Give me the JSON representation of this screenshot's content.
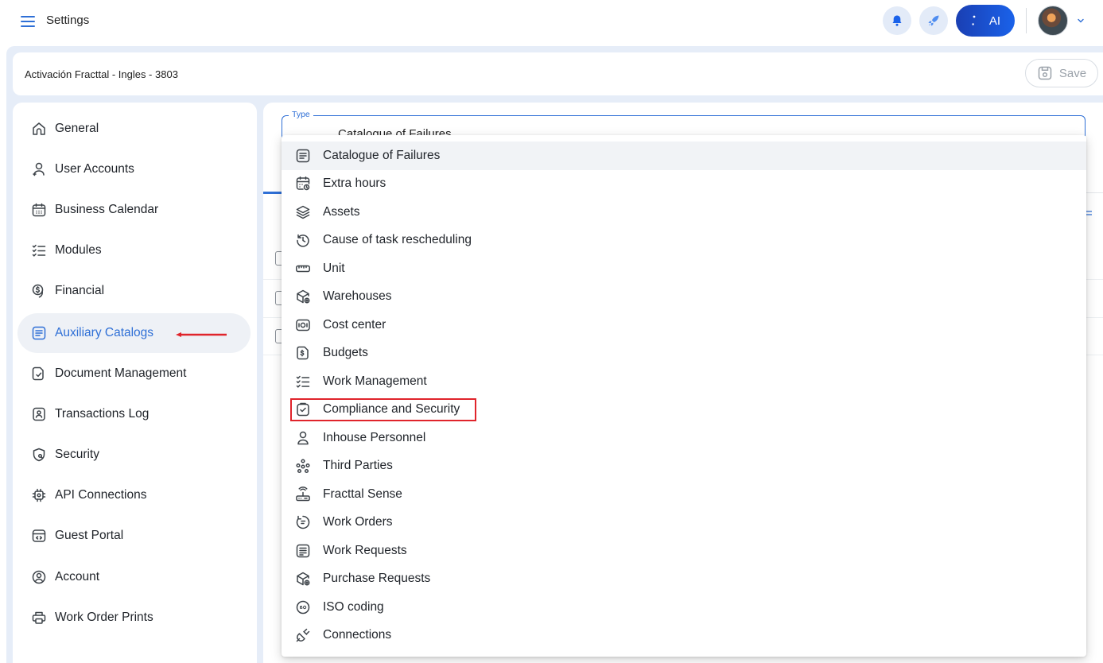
{
  "topbar": {
    "title": "Settings",
    "ai_label": "AI"
  },
  "subheader": {
    "title": "Activación Fracttal - Ingles - 3803",
    "save_label": "Save"
  },
  "sidebar": {
    "items": [
      {
        "label": "General",
        "icon": "home-icon"
      },
      {
        "label": "User Accounts",
        "icon": "user-plus-icon"
      },
      {
        "label": "Business Calendar",
        "icon": "calendar-icon"
      },
      {
        "label": "Modules",
        "icon": "checklist-icon"
      },
      {
        "label": "Financial",
        "icon": "coins-icon"
      },
      {
        "label": "Auxiliary Catalogs",
        "icon": "catalog-icon",
        "active": true
      },
      {
        "label": "Document Management",
        "icon": "document-icon"
      },
      {
        "label": "Transactions Log",
        "icon": "log-icon"
      },
      {
        "label": "Security",
        "icon": "shield-icon"
      },
      {
        "label": "API Connections",
        "icon": "chip-gear-icon"
      },
      {
        "label": "Guest Portal",
        "icon": "portal-icon"
      },
      {
        "label": "Account",
        "icon": "account-icon"
      },
      {
        "label": "Work Order Prints",
        "icon": "printer-icon"
      }
    ]
  },
  "type_field": {
    "label": "Type",
    "value": "Catalogue of Failures"
  },
  "dropdown": {
    "options": [
      {
        "label": "Catalogue of Failures",
        "icon": "list-doc-icon",
        "hover": true
      },
      {
        "label": "Extra hours",
        "icon": "calendar-clock-icon"
      },
      {
        "label": "Assets",
        "icon": "layers-icon"
      },
      {
        "label": "Cause of task rescheduling",
        "icon": "history-icon"
      },
      {
        "label": "Unit",
        "icon": "ruler-icon"
      },
      {
        "label": "Warehouses",
        "icon": "box-plus-icon"
      },
      {
        "label": "Cost center",
        "icon": "cost-center-icon"
      },
      {
        "label": "Budgets",
        "icon": "budget-icon"
      },
      {
        "label": "Work Management",
        "icon": "checklist-icon"
      },
      {
        "label": "Compliance and Security",
        "icon": "clipboard-check-icon",
        "highlighted": true
      },
      {
        "label": "Inhouse Personnel",
        "icon": "person-icon"
      },
      {
        "label": "Third Parties",
        "icon": "people-network-icon"
      },
      {
        "label": "Fracttal Sense",
        "icon": "router-icon"
      },
      {
        "label": "Work Orders",
        "icon": "work-order-icon"
      },
      {
        "label": "Work Requests",
        "icon": "work-request-icon"
      },
      {
        "label": "Purchase Requests",
        "icon": "box-plus-icon"
      },
      {
        "label": "ISO coding",
        "icon": "iso-icon"
      },
      {
        "label": "Connections",
        "icon": "plug-icon"
      }
    ]
  },
  "colors": {
    "accent": "#2e6fd6",
    "annotation_red": "#e0242b",
    "shell_bg": "#e6edf8"
  }
}
